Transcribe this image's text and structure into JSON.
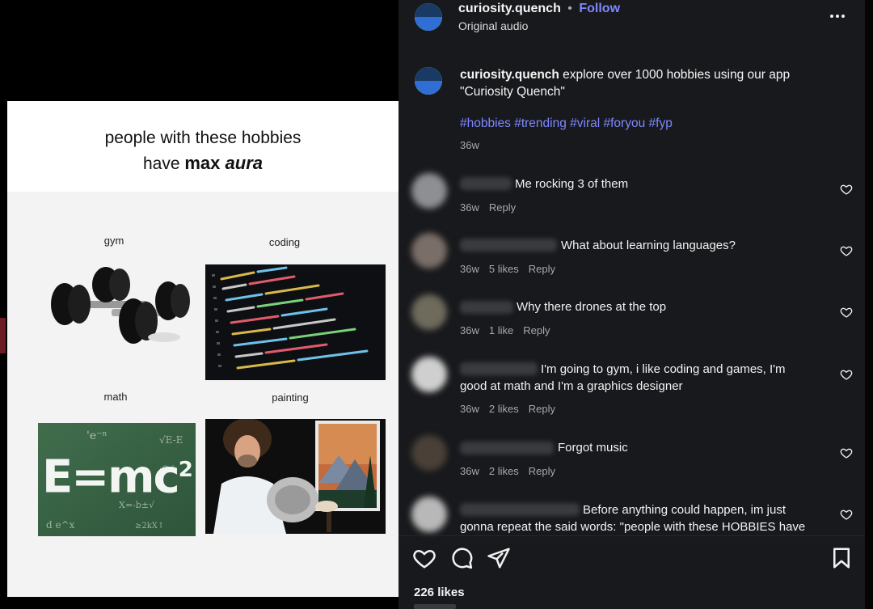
{
  "post": {
    "headline_line1": "people with these hobbies",
    "headline_have": "have ",
    "headline_max": "max ",
    "headline_aura": "aura",
    "hobbies": {
      "gym": "gym",
      "coding": "coding",
      "math": "math",
      "painting": "painting"
    },
    "math_formula": "E=mc",
    "math_exp": "2"
  },
  "header": {
    "username": "curiosity.quench",
    "dot": "•",
    "follow": "Follow",
    "audio": "Original audio",
    "more_icon": "more-icon"
  },
  "caption": {
    "username": "curiosity.quench",
    "text": " explore over 1000 hobbies using our app \"Curiosity Quench\"",
    "hashtags": "#hobbies #trending #viral #foryou #fyp",
    "time": "36w"
  },
  "comments": [
    {
      "text": "Me rocking 3 of them",
      "time": "36w",
      "likes": "",
      "reply": "Reply"
    },
    {
      "text": "What about learning languages?",
      "time": "36w",
      "likes": "5 likes",
      "reply": "Reply"
    },
    {
      "text": "Why there drones at the top",
      "time": "36w",
      "likes": "1 like",
      "reply": "Reply"
    },
    {
      "text": "I'm going to gym, i like coding and games, I'm",
      "text2": "good at math and I'm a graphics designer",
      "time": "36w",
      "likes": "2 likes",
      "reply": "Reply"
    },
    {
      "text": "Forgot music",
      "time": "36w",
      "likes": "2 likes",
      "reply": "Reply"
    },
    {
      "text": "Before anything could happen, im just",
      "text2": "gonna repeat the said words: \"people with these HOBBIES have"
    }
  ],
  "actions": {
    "like_icon": "heart-icon",
    "comment_icon": "comment-icon",
    "share_icon": "share-icon",
    "save_icon": "bookmark-icon"
  },
  "likes_count": "226 likes",
  "colors": {
    "panel_bg": "#18191c",
    "link": "#7d88ff",
    "muted": "#a8a8a8"
  }
}
